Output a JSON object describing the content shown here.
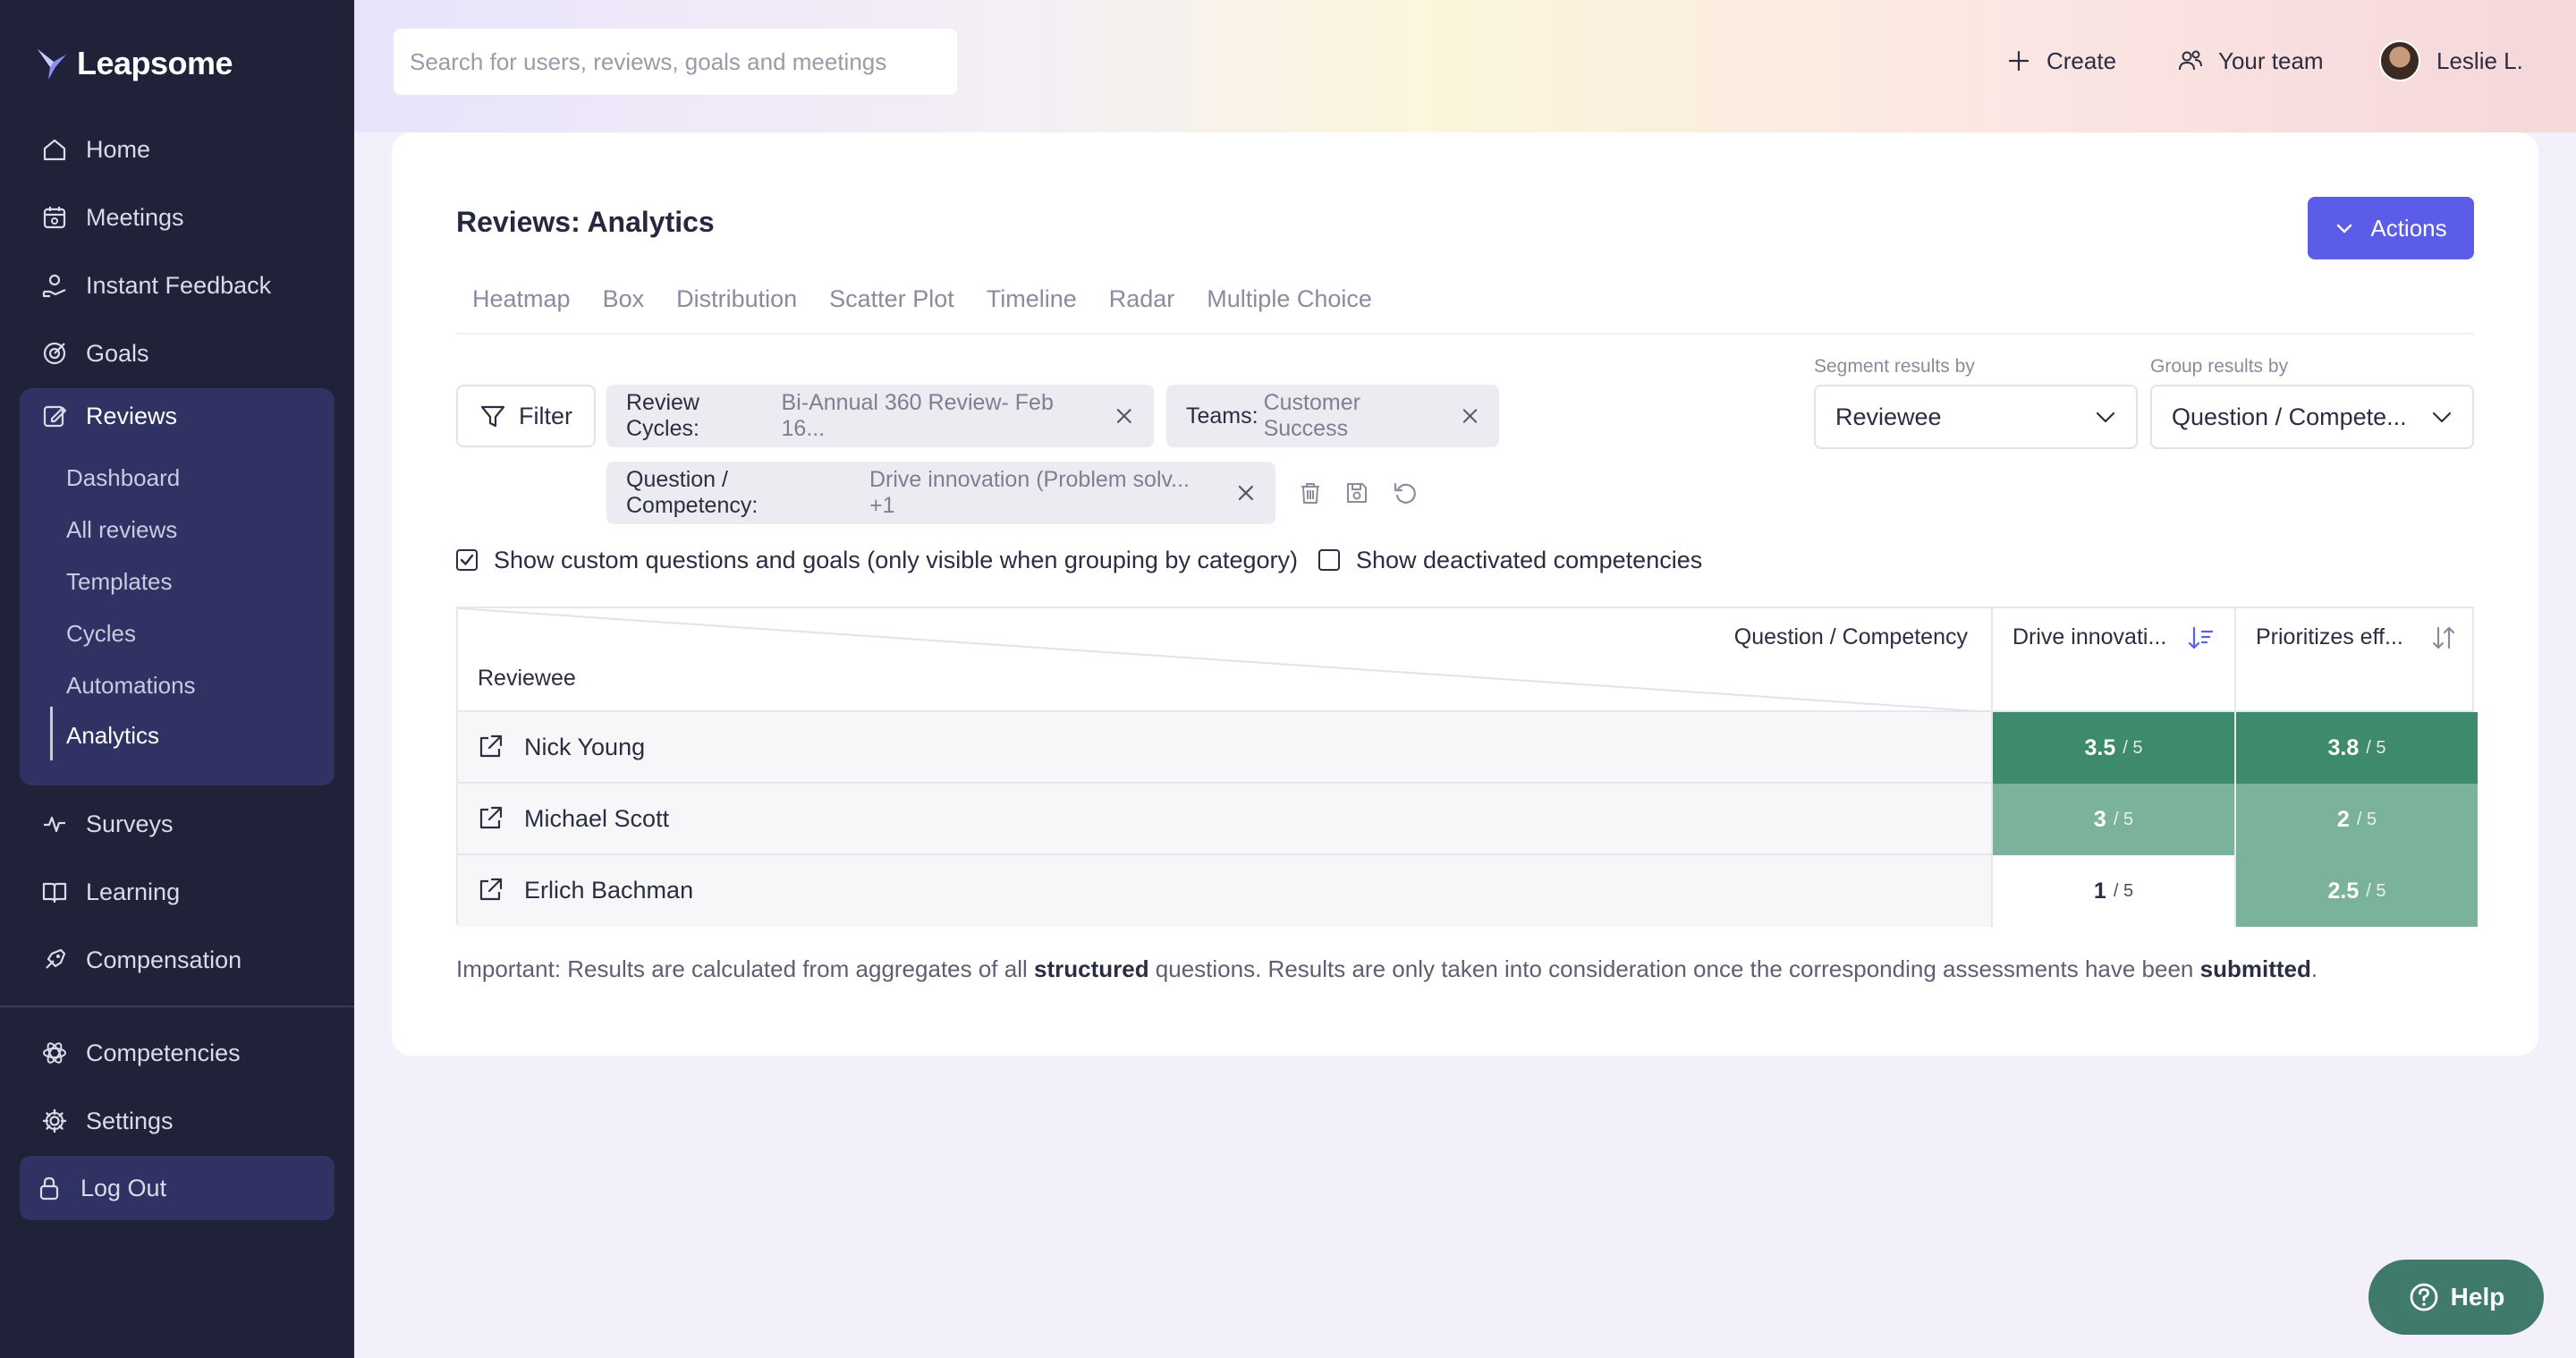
{
  "app": {
    "name": "Leapsome"
  },
  "sidebar": {
    "items": [
      {
        "label": "Home"
      },
      {
        "label": "Meetings"
      },
      {
        "label": "Instant Feedback"
      },
      {
        "label": "Goals"
      },
      {
        "label": "Reviews"
      },
      {
        "label": "Surveys"
      },
      {
        "label": "Learning"
      },
      {
        "label": "Compensation"
      },
      {
        "label": "Competencies"
      },
      {
        "label": "Settings"
      },
      {
        "label": "Log Out"
      }
    ],
    "review_subitems": [
      {
        "label": "Dashboard"
      },
      {
        "label": "All reviews"
      },
      {
        "label": "Templates"
      },
      {
        "label": "Cycles"
      },
      {
        "label": "Automations"
      },
      {
        "label": "Analytics"
      }
    ]
  },
  "topbar": {
    "search_placeholder": "Search for users, reviews, goals and meetings",
    "create_label": "Create",
    "team_label": "Your team",
    "user_name": "Leslie L."
  },
  "page": {
    "title": "Reviews: Analytics",
    "actions_label": "Actions",
    "tabs": [
      "Heatmap",
      "Box",
      "Distribution",
      "Scatter Plot",
      "Timeline",
      "Radar",
      "Multiple Choice"
    ],
    "filter_label": "Filter",
    "chips": [
      {
        "key": "Review Cycles:",
        "value": "Bi-Annual 360 Review- Feb 16..."
      },
      {
        "key": "Teams:",
        "value": "Customer Success"
      },
      {
        "key": "Question / Competency:",
        "value": "Drive innovation (Problem solv... +1"
      }
    ],
    "segment": {
      "label": "Segment results by",
      "value": "Reviewee"
    },
    "group": {
      "label": "Group results by",
      "value": "Question / Compete..."
    },
    "show_custom_label": "Show custom questions and goals (only visible when grouping by category)",
    "show_deactivated_label": "Show deactivated competencies",
    "table": {
      "header_top": "Question / Competency",
      "header_left": "Reviewee",
      "columns": [
        "Drive innovati...",
        "Prioritizes eff..."
      ],
      "rows": [
        {
          "name": "Nick Young",
          "values": [
            "3.5",
            "3.8"
          ]
        },
        {
          "name": "Michael Scott",
          "values": [
            "3",
            "2"
          ]
        },
        {
          "name": "Erlich Bachman",
          "values": [
            "1",
            "2.5"
          ]
        }
      ],
      "denominator": "/ 5"
    },
    "note": {
      "part1": "Important: Results are calculated from aggregates of all ",
      "bold1": "structured",
      "part2": " questions. Results are only taken into consideration once the corresponding assessments have been ",
      "bold2": "submitted",
      "part3": "."
    },
    "help_label": "Help"
  },
  "colors": {
    "sidebar_bg": "#20223a",
    "accent": "#5b5de8",
    "heat_high": "#3e8a6c",
    "heat_mid": "#7ab29c",
    "heat_low": "#ffffff",
    "help": "#3f7a6a"
  }
}
